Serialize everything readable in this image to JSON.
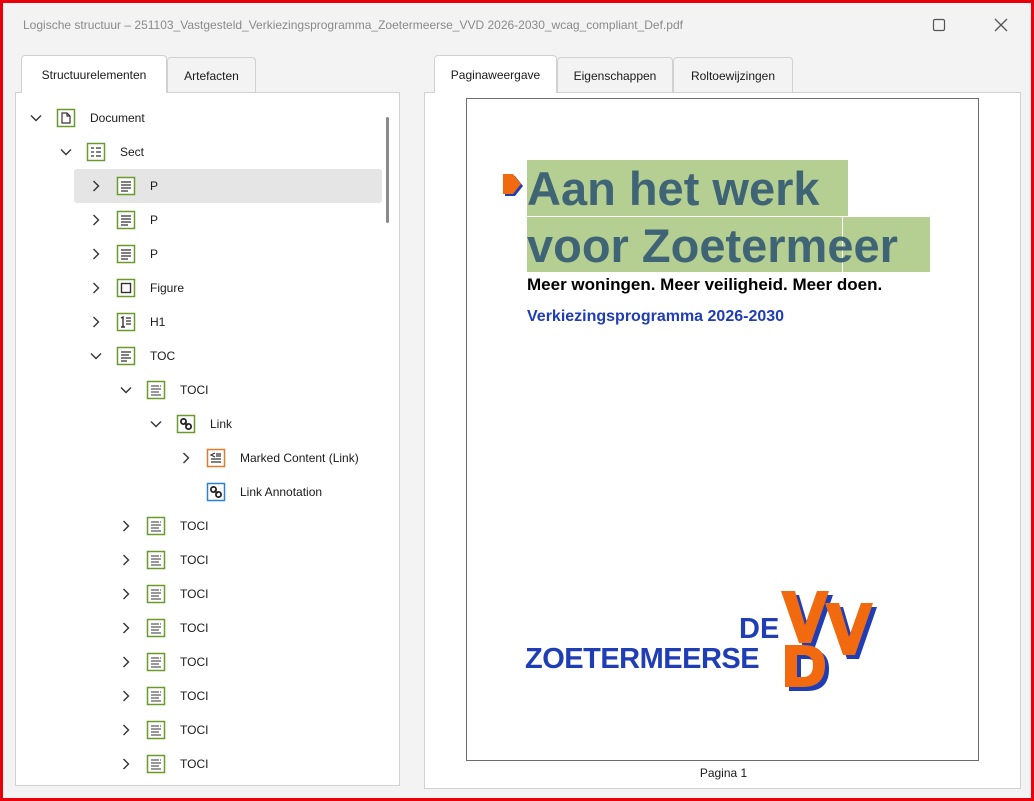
{
  "window": {
    "title": "Logische structuur – 251103_Vastgesteld_Verkiezingsprogramma_Zoetermeerse_VVD 2026-2030_wcag_compliant_Def.pdf"
  },
  "left_tabs": [
    "Structuurelementen",
    "Artefacten"
  ],
  "right_tabs": [
    "Paginaweergave",
    "Eigenschappen",
    "Roltoewijzingen"
  ],
  "tree": [
    {
      "label": "Document",
      "icon": "document-icon",
      "expanded": true
    },
    {
      "label": "Sect",
      "icon": "section-icon",
      "expanded": true
    },
    {
      "label": "P",
      "icon": "paragraph-icon",
      "expanded": false,
      "selected": true
    },
    {
      "label": "P",
      "icon": "paragraph-icon",
      "expanded": false
    },
    {
      "label": "P",
      "icon": "paragraph-icon",
      "expanded": false
    },
    {
      "label": "Figure",
      "icon": "figure-icon",
      "expanded": false
    },
    {
      "label": "H1",
      "icon": "heading-icon",
      "expanded": false
    },
    {
      "label": "TOC",
      "icon": "toc-icon",
      "expanded": true
    },
    {
      "label": "TOCI",
      "icon": "toc-item-icon",
      "expanded": true
    },
    {
      "label": "Link",
      "icon": "link-icon",
      "expanded": true
    },
    {
      "label": "Marked Content (Link)",
      "icon": "marked-content-icon",
      "expanded": false
    },
    {
      "label": "Link Annotation",
      "icon": "link-annotation-icon"
    },
    {
      "label": "TOCI",
      "icon": "toc-item-icon",
      "expanded": false
    },
    {
      "label": "TOCI",
      "icon": "toc-item-icon",
      "expanded": false
    },
    {
      "label": "TOCI",
      "icon": "toc-item-icon",
      "expanded": false
    },
    {
      "label": "TOCI",
      "icon": "toc-item-icon",
      "expanded": false
    },
    {
      "label": "TOCI",
      "icon": "toc-item-icon",
      "expanded": false
    },
    {
      "label": "TOCI",
      "icon": "toc-item-icon",
      "expanded": false
    },
    {
      "label": "TOCI",
      "icon": "toc-item-icon",
      "expanded": false
    },
    {
      "label": "TOCI",
      "icon": "toc-item-icon",
      "expanded": false
    }
  ],
  "page_preview": {
    "headline_line1": "Aan het werk",
    "headline_line2": "voor Zoetermeer",
    "subtitle": "Meer woningen. Meer veiligheid. Meer doen.",
    "program": "Verkiezingsprogramma 2026-2030",
    "logo_text_main": "ZOETERMEERSE",
    "logo_text_de": "DE",
    "logo_letters": "VVD",
    "page_label": "Pagina 1"
  },
  "colors": {
    "highlight": "#b5cf92",
    "headline": "#3f6475",
    "brand_blue": "#1f3db5",
    "brand_orange": "#f26a10",
    "selection": "#e5e5e5",
    "frame_red": "#e8000b"
  }
}
